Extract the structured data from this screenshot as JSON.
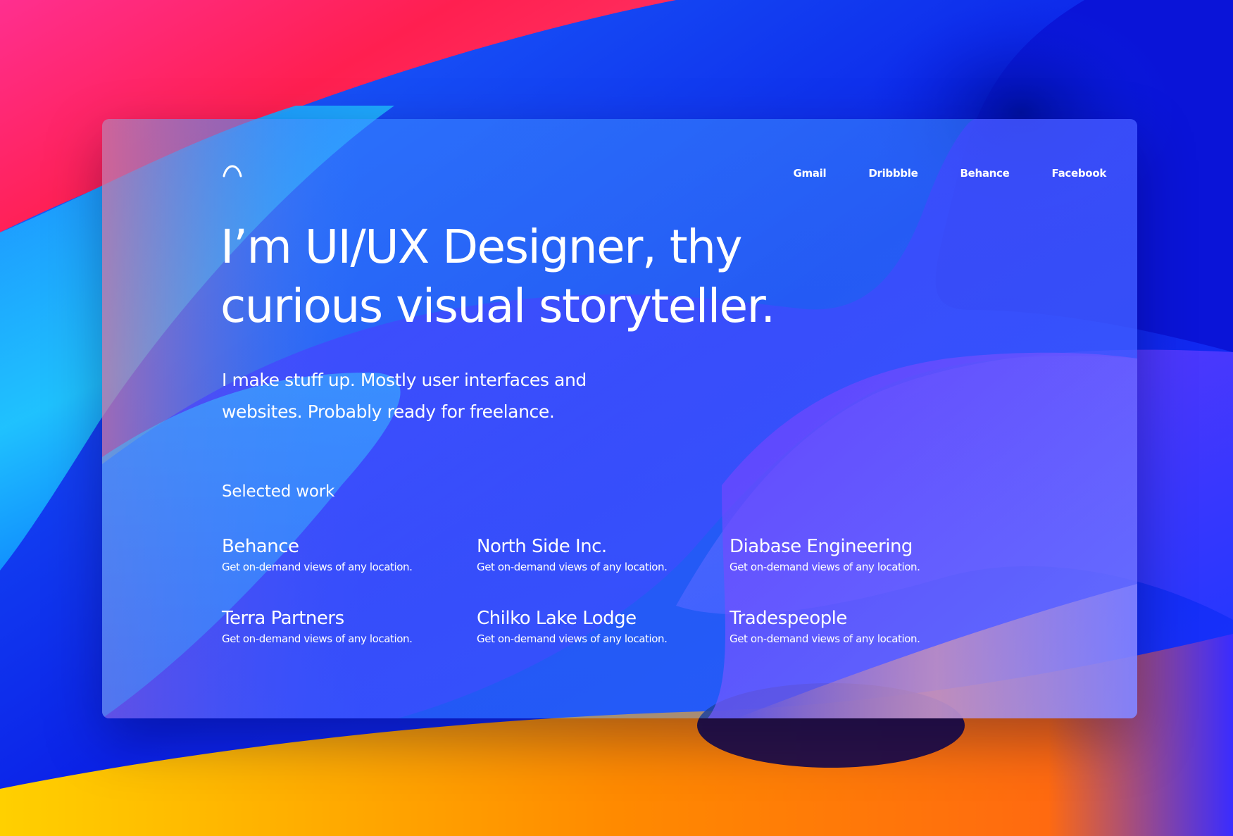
{
  "colors": {
    "accent": "#3a86ff",
    "text": "#ffffff",
    "bg_deep_blue": "#0a1ee6",
    "bg_pink": "#ff2b7a",
    "bg_orange": "#ff8a00",
    "bg_cyan": "#2fd0ff",
    "bg_purple": "#6a3cff"
  },
  "header": {
    "logo_icon": "chevron-up-icon",
    "nav": [
      {
        "label": "Gmail"
      },
      {
        "label": "Dribbble"
      },
      {
        "label": "Behance"
      },
      {
        "label": "Facebook"
      }
    ]
  },
  "hero": {
    "headline_line1": "I’m UI/UX Designer, thy",
    "headline_line2": "curious visual storyteller.",
    "intro_line1": "I make stuff up. Mostly user interfaces and",
    "intro_line2": "websites. Probably ready for freelance."
  },
  "work": {
    "section_label": "Selected work",
    "items": [
      {
        "title": "Behance",
        "description": "Get on-demand views of any location."
      },
      {
        "title": "North Side Inc.",
        "description": "Get on-demand views of any location."
      },
      {
        "title": "Diabase Engineering",
        "description": "Get on-demand views of any location."
      },
      {
        "title": "Terra Partners",
        "description": "Get on-demand views of any location."
      },
      {
        "title": "Chilko Lake Lodge",
        "description": "Get on-demand views of any location."
      },
      {
        "title": "Tradespeople",
        "description": "Get on-demand views of any location."
      }
    ]
  }
}
